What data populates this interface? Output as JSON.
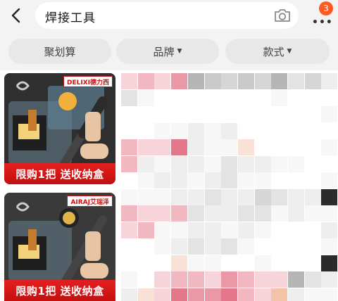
{
  "header": {
    "search_query": "焊接工具",
    "cart_badge": "3",
    "icons": [
      "back-arrow-icon",
      "camera-icon",
      "more-dots-icon"
    ]
  },
  "filters": [
    {
      "label": "聚划算",
      "dropdown": false
    },
    {
      "label": "品牌",
      "dropdown": true
    },
    {
      "label": "款式",
      "dropdown": true
    }
  ],
  "products": [
    {
      "promo": "限购1把 送收纳盒",
      "brand": "DELIXI德力西"
    },
    {
      "promo": "限购1把 送收纳盒",
      "brand": "AIRAJ艾瑞泽"
    }
  ],
  "colors": {
    "accent": "#ff5a1f",
    "promo_red": "#d91515"
  }
}
